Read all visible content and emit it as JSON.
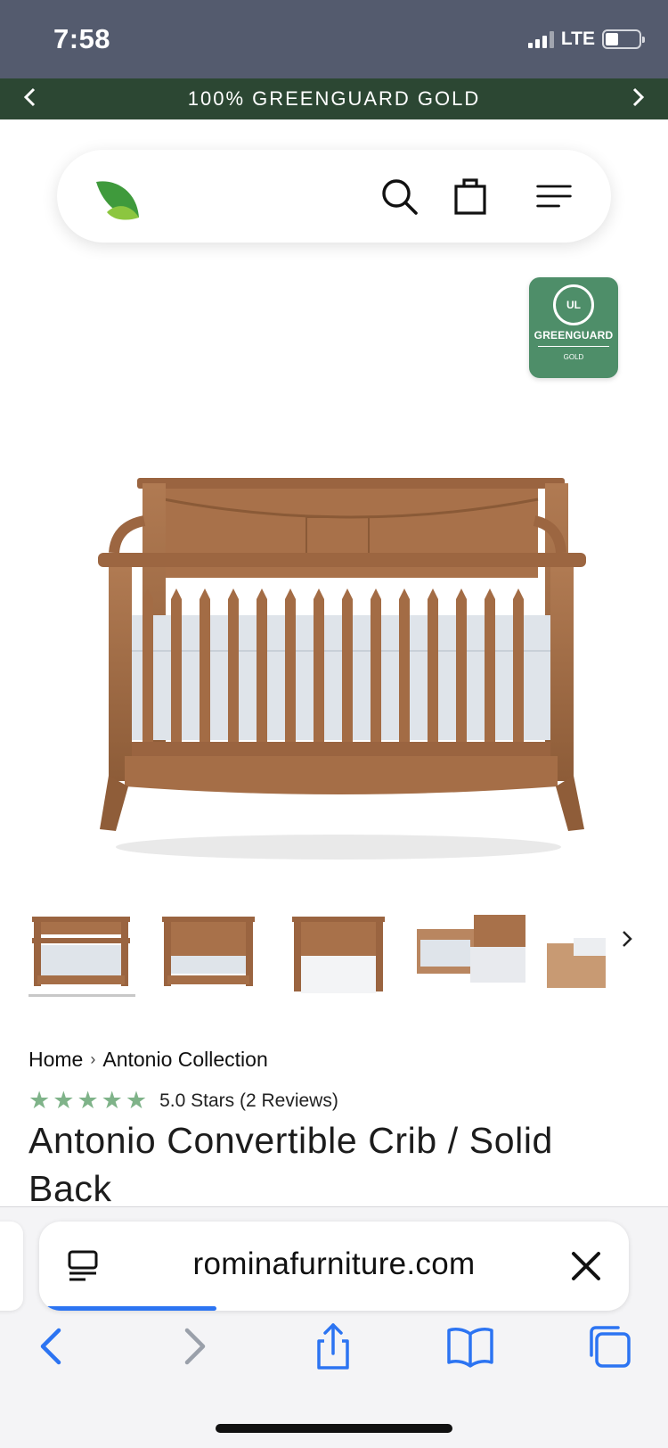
{
  "status_bar": {
    "time": "7:58",
    "network": "LTE"
  },
  "announcement": {
    "text": "100% GREENGUARD GOLD",
    "prev_icon": "chevron-left-icon",
    "next_icon": "chevron-right-icon"
  },
  "header": {
    "logo_icon": "leaf-logo-icon",
    "icons": [
      "search-icon",
      "shopping-bag-icon",
      "menu-icon"
    ]
  },
  "badge": {
    "mark": "UL",
    "title": "GREENGUARD",
    "subtitle": "GOLD",
    "color": "#4e8e69"
  },
  "gallery": {
    "thumbnail_count": 5,
    "next_icon": "chevron-right-icon"
  },
  "product": {
    "breadcrumb": {
      "home": "Home",
      "separator": "›",
      "collection": "Antonio Collection"
    },
    "rating": {
      "stars": 5,
      "text": "5.0 Stars (2 Reviews)",
      "star_color": "#7fb389"
    },
    "title": "Antonio Convertible Crib / Solid Back"
  },
  "browser": {
    "url": "rominafurniture.com",
    "load_progress": 0.3,
    "accent_color": "#2c74f2",
    "toolbar_icons": [
      "back-icon",
      "forward-icon",
      "share-icon",
      "bookmarks-icon",
      "tabs-icon"
    ]
  },
  "colors": {
    "status_bar": "#545b6e",
    "announcement_bar": "#2c4733",
    "wood": "#a86f47"
  }
}
